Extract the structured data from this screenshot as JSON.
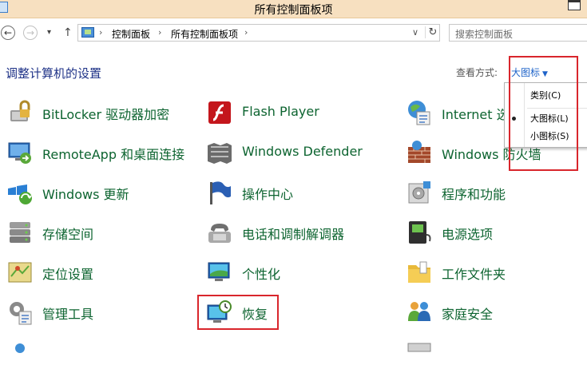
{
  "window": {
    "title": "所有控制面板项"
  },
  "nav": {
    "back": "←",
    "forward": "→",
    "recent": "▾",
    "up": "↑",
    "breadcrumb": [
      "控制面板",
      "所有控制面板项"
    ],
    "separator": "›",
    "dropdown": "∨",
    "refresh": "↻"
  },
  "search": {
    "placeholder": "搜索控制面板"
  },
  "header": {
    "title": "调整计算机的设置",
    "view_by_label": "查看方式:",
    "view_by_value": "大图标",
    "view_by_arrow": "▼"
  },
  "view_menu": {
    "items": [
      "类别(C)",
      "大图标(L)",
      "小图标(S)"
    ],
    "selected": "大图标(L)"
  },
  "items": [
    {
      "label": "BitLocker 驱动器加密",
      "icon": "bitlocker-icon"
    },
    {
      "label": "Flash Player",
      "icon": "flash-icon"
    },
    {
      "label": "Internet 选",
      "icon": "internet-options-icon"
    },
    {
      "label": "RemoteApp 和桌面连接",
      "icon": "remoteapp-icon"
    },
    {
      "label": "Windows Defender",
      "icon": "defender-icon"
    },
    {
      "label": "Windows 防火墙",
      "icon": "firewall-icon"
    },
    {
      "label": "Windows 更新",
      "icon": "windows-update-icon"
    },
    {
      "label": "操作中心",
      "icon": "action-center-icon"
    },
    {
      "label": "程序和功能",
      "icon": "programs-icon"
    },
    {
      "label": "存储空间",
      "icon": "storage-spaces-icon"
    },
    {
      "label": "电话和调制解调器",
      "icon": "phone-modem-icon"
    },
    {
      "label": "电源选项",
      "icon": "power-options-icon"
    },
    {
      "label": "定位设置",
      "icon": "location-icon"
    },
    {
      "label": "个性化",
      "icon": "personalization-icon"
    },
    {
      "label": "工作文件夹",
      "icon": "work-folders-icon"
    },
    {
      "label": "管理工具",
      "icon": "admin-tools-icon"
    },
    {
      "label": "恢复",
      "icon": "recovery-icon"
    },
    {
      "label": "家庭安全",
      "icon": "family-safety-icon"
    }
  ],
  "colors": {
    "link_green": "#0d6430",
    "title_blue": "#1e3287",
    "highlight_red": "#d9262c",
    "titlebar": "#f7e0c0"
  }
}
